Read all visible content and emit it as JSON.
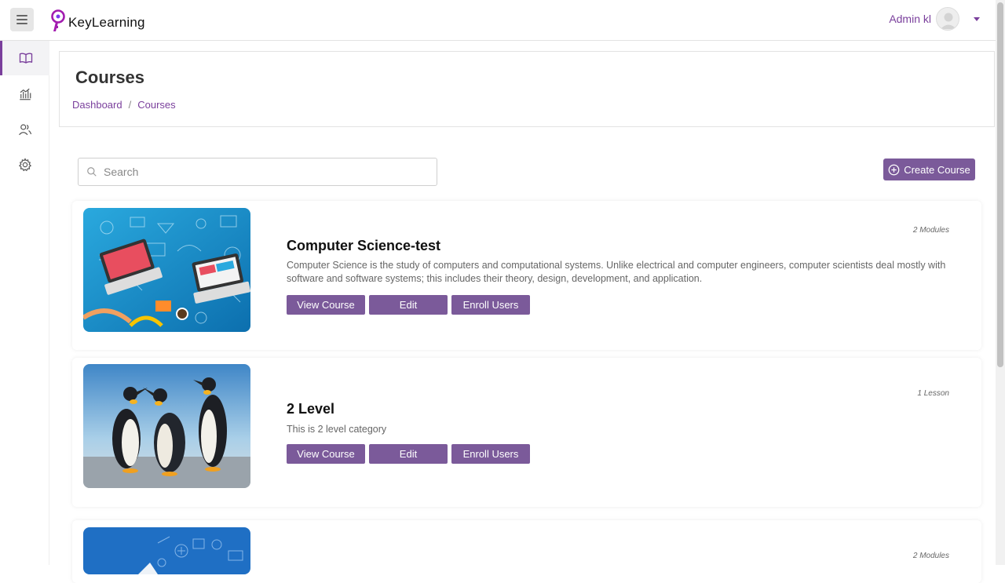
{
  "app": {
    "logo_text": "KeyLearning"
  },
  "header": {
    "user_name": "Admin kl"
  },
  "sidebar": {
    "items": [
      {
        "icon": "book-icon"
      },
      {
        "icon": "chart-icon"
      },
      {
        "icon": "users-icon"
      },
      {
        "icon": "gear-icon"
      }
    ]
  },
  "page": {
    "title": "Courses",
    "breadcrumb": [
      "Dashboard",
      "/",
      "Courses"
    ]
  },
  "search": {
    "placeholder": "Search"
  },
  "toolbar": {
    "create_label": "Create Course"
  },
  "courses": [
    {
      "title": "Computer Science-test",
      "description": "Computer Science is the study of computers and computational systems. Unlike electrical and computer engineers, computer scientists deal mostly with software and software systems; this includes their theory, design, development, and application.",
      "count": "2 Modules",
      "buttons": [
        "View Course",
        "Edit",
        "Enroll Users"
      ]
    },
    {
      "title": "2 Level",
      "description": "This is 2 level category",
      "count": "1 Lesson",
      "buttons": [
        "View Course",
        "Edit",
        "Enroll Users"
      ]
    },
    {
      "count": "2 Modules"
    }
  ],
  "colors": {
    "accent": "#7b5a9a",
    "link": "#7a3f9c"
  }
}
